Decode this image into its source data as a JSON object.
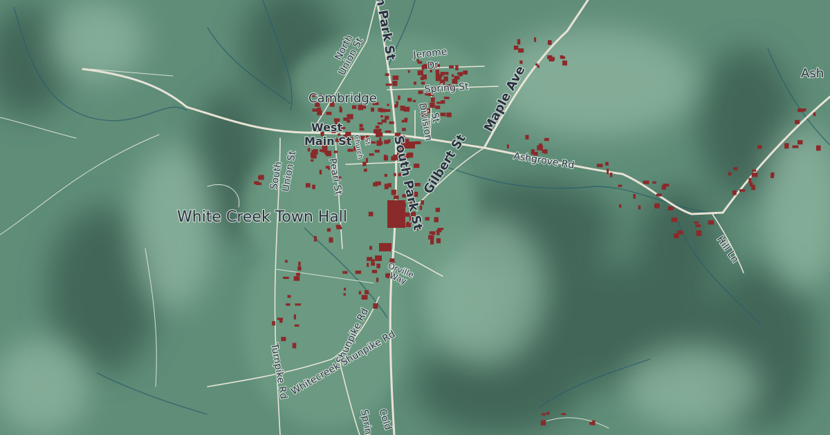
{
  "map": {
    "place_labels": {
      "cambridge": "Cambridge",
      "town_hall": "White Creek Town Hall",
      "ash_partial": "Ash"
    },
    "street_labels": {
      "north_park_st": "North Park St",
      "north_union_st_1": "North",
      "north_union_st_2": "Union St",
      "jerome_dr_1": "Jerome",
      "jerome_dr_2": "Dr",
      "spring_st": "Spring St",
      "division_st_1": "Division",
      "division_st_2": "St",
      "maple_ave": "Maple Ave",
      "west_main_st_1": "West",
      "west_main_st_2": "Main St",
      "south_union_st_1": "South",
      "south_union_st_2": "Union St",
      "pearl_st": "Pearl St",
      "church_st_1": "Church",
      "church_st_2": "St",
      "south_park_st": "South Park St",
      "gilbert_st": "Gilbert St",
      "ashgrove_rd": "Ashgrove Rd",
      "hill_ln": "Hill Ln",
      "orville_way_1": "Orville",
      "orville_way_2": "Way",
      "shunpike_rd": "Shunpike Rd",
      "whitecreek_shunpike_rd": "Whitecreek Shunpike Rd",
      "turnpike_rd": "Turnpike Rd",
      "spring_partial": "Spring",
      "cold_partial": "Cold"
    },
    "colors": {
      "terrain": "#5f8d78",
      "terrain_dark": "#3f6656",
      "terrain_light": "#8cb39f",
      "road": "#e8e3d6",
      "building": "#8a2a2a",
      "stream": "#2b5f6a",
      "label_text": "#2c3140",
      "label_halo": "#cfe0d6"
    }
  }
}
